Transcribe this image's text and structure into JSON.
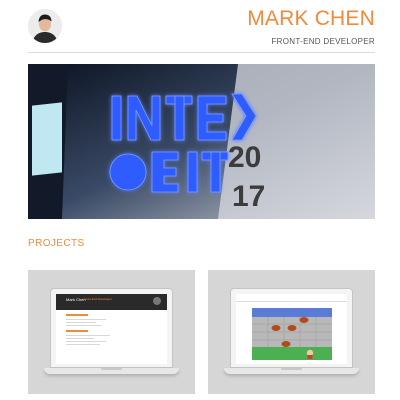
{
  "header": {
    "name": "MARK CHEN",
    "role": "FRONT-END DEVELOPER",
    "avatar_icon": "person-portrait-icon"
  },
  "hero": {
    "image": "inter-exit-2017-neon-sign",
    "sign_text": "NTEX",
    "sign_text_2": "IT",
    "year_top": "20",
    "year_bottom": "17"
  },
  "projects": {
    "title": "PROJECTS",
    "items": [
      {
        "preview": "portfolio-site-preview",
        "mini_title": "Mark Chen",
        "mini_subtitle": "Front-End Developer"
      },
      {
        "preview": "frogger-game-preview"
      }
    ]
  },
  "colors": {
    "accent": "#f08a3c",
    "hero_blue": "#1e4dff",
    "card_bg": "#d6d6d6"
  }
}
